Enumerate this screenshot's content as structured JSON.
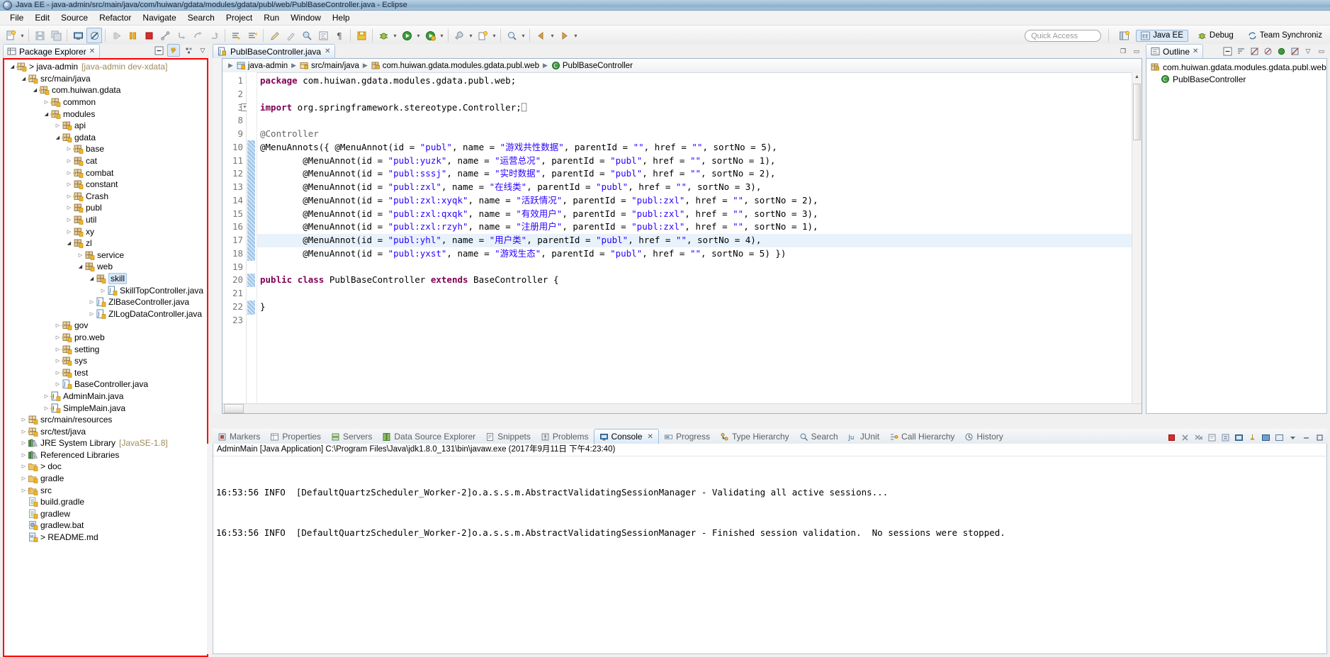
{
  "window": {
    "title": "Java EE - java-admin/src/main/java/com/huiwan/gdata/modules/gdata/publ/web/PublBaseController.java - Eclipse"
  },
  "menubar": {
    "items": [
      "File",
      "Edit",
      "Source",
      "Refactor",
      "Navigate",
      "Search",
      "Project",
      "Run",
      "Window",
      "Help"
    ]
  },
  "toolbar": {
    "quick_access_placeholder": "Quick Access",
    "perspectives": [
      {
        "label": "Java EE",
        "active": true
      },
      {
        "label": "Debug",
        "active": false
      },
      {
        "label": "Team Synchroniz",
        "active": false
      }
    ]
  },
  "package_explorer": {
    "tab_label": "Package Explorer",
    "tools": [
      "collapse-all-icon",
      "link-with-editor-icon",
      "view-menu-icon",
      "minimize-icon",
      "maximize-icon"
    ],
    "tree": [
      {
        "depth": 0,
        "label": "> java-admin",
        "suffix": "[java-admin dev-xdata]",
        "icon": "package-root-warn",
        "state": "open"
      },
      {
        "depth": 1,
        "label": "src/main/java",
        "icon": "source-folder-warn",
        "state": "open"
      },
      {
        "depth": 2,
        "label": "com.huiwan.gdata",
        "icon": "package-warn",
        "state": "open"
      },
      {
        "depth": 3,
        "label": "common",
        "icon": "package-warn",
        "state": "closed"
      },
      {
        "depth": 3,
        "label": "modules",
        "icon": "package-warn",
        "state": "open"
      },
      {
        "depth": 4,
        "label": "api",
        "icon": "package",
        "state": "closed"
      },
      {
        "depth": 4,
        "label": "gdata",
        "icon": "package-warn",
        "state": "open"
      },
      {
        "depth": 5,
        "label": "base",
        "icon": "package-warn",
        "state": "closed"
      },
      {
        "depth": 5,
        "label": "cat",
        "icon": "package",
        "state": "closed"
      },
      {
        "depth": 5,
        "label": "combat",
        "icon": "package-warn",
        "state": "closed"
      },
      {
        "depth": 5,
        "label": "constant",
        "icon": "package",
        "state": "closed"
      },
      {
        "depth": 5,
        "label": "Crash",
        "icon": "package-warn",
        "state": "closed"
      },
      {
        "depth": 5,
        "label": "publ",
        "icon": "package",
        "state": "closed"
      },
      {
        "depth": 5,
        "label": "util",
        "icon": "package",
        "state": "closed"
      },
      {
        "depth": 5,
        "label": "xy",
        "icon": "package",
        "state": "closed"
      },
      {
        "depth": 5,
        "label": "zl",
        "icon": "package",
        "state": "open"
      },
      {
        "depth": 6,
        "label": "service",
        "icon": "package",
        "state": "closed"
      },
      {
        "depth": 6,
        "label": "web",
        "icon": "package",
        "state": "open"
      },
      {
        "depth": 7,
        "label": "skill",
        "icon": "package",
        "state": "open",
        "selected": true
      },
      {
        "depth": 8,
        "label": "SkillTopController.java",
        "icon": "java-file",
        "state": "closed"
      },
      {
        "depth": 7,
        "label": "ZlBaseController.java",
        "icon": "java-file",
        "state": "closed"
      },
      {
        "depth": 7,
        "label": "ZlLogDataController.java",
        "icon": "java-file",
        "state": "closed"
      },
      {
        "depth": 4,
        "label": "gov",
        "icon": "package-warn",
        "state": "closed"
      },
      {
        "depth": 4,
        "label": "pro.web",
        "icon": "package-warn",
        "state": "closed"
      },
      {
        "depth": 4,
        "label": "setting",
        "icon": "package-warn",
        "state": "closed"
      },
      {
        "depth": 4,
        "label": "sys",
        "icon": "package-warn",
        "state": "closed"
      },
      {
        "depth": 4,
        "label": "test",
        "icon": "package-warn",
        "state": "closed"
      },
      {
        "depth": 4,
        "label": "BaseController.java",
        "icon": "java-file",
        "state": "closed"
      },
      {
        "depth": 3,
        "label": "AdminMain.java",
        "icon": "java-file-warn",
        "state": "closed"
      },
      {
        "depth": 3,
        "label": "SimpleMain.java",
        "icon": "java-file-warn",
        "state": "closed"
      },
      {
        "depth": 1,
        "label": "src/main/resources",
        "icon": "source-folder",
        "state": "closed"
      },
      {
        "depth": 1,
        "label": "src/test/java",
        "icon": "source-folder-warn",
        "state": "closed"
      },
      {
        "depth": 1,
        "label": "JRE System Library",
        "suffix": "[JavaSE-1.8]",
        "icon": "library",
        "state": "closed"
      },
      {
        "depth": 1,
        "label": "Referenced Libraries",
        "icon": "library",
        "state": "closed"
      },
      {
        "depth": 1,
        "label": "> doc",
        "icon": "folder",
        "state": "closed"
      },
      {
        "depth": 1,
        "label": "gradle",
        "icon": "folder",
        "state": "closed"
      },
      {
        "depth": 1,
        "label": "src",
        "icon": "folder-warn",
        "state": "closed"
      },
      {
        "depth": 1,
        "label": "build.gradle",
        "icon": "text-file",
        "state": "leaf"
      },
      {
        "depth": 1,
        "label": "gradlew",
        "icon": "text-file",
        "state": "leaf"
      },
      {
        "depth": 1,
        "label": "gradlew.bat",
        "icon": "bat-file",
        "state": "leaf"
      },
      {
        "depth": 1,
        "label": "> README.md",
        "icon": "md-file",
        "state": "leaf"
      }
    ]
  },
  "editor": {
    "tab_label": "PublBaseController.java",
    "breadcrumb": [
      {
        "label": "java-admin",
        "icon": "project-icon"
      },
      {
        "label": "src/main/java",
        "icon": "source-folder-icon"
      },
      {
        "label": "com.huiwan.gdata.modules.gdata.publ.web",
        "icon": "package-icon"
      },
      {
        "label": "PublBaseController",
        "icon": "class-icon"
      }
    ],
    "line_numbers": [
      1,
      2,
      3,
      8,
      9,
      10,
      11,
      12,
      13,
      14,
      15,
      16,
      17,
      18,
      19,
      20,
      21,
      22,
      23
    ],
    "lines": [
      {
        "num": 1,
        "tokens": [
          {
            "t": "package",
            "c": "kw"
          },
          {
            "t": " com.huiwan.gdata.modules.gdata.publ.web;",
            "c": "plain"
          }
        ]
      },
      {
        "num": 2,
        "tokens": []
      },
      {
        "num": 3,
        "fold": true,
        "tokens": [
          {
            "t": "import",
            "c": "kw"
          },
          {
            "t": " org.springframework.stereotype.Controller;",
            "c": "plain"
          },
          {
            "t": "⎕",
            "c": "anno"
          }
        ]
      },
      {
        "num": 8,
        "tokens": []
      },
      {
        "num": 9,
        "tokens": [
          {
            "t": "@Controller",
            "c": "anno"
          }
        ]
      },
      {
        "num": 10,
        "tokens": [
          {
            "t": "@MenuAnnots({ @MenuAnnot(id = ",
            "c": "plain"
          },
          {
            "t": "\"publ\"",
            "c": "str"
          },
          {
            "t": ", name = ",
            "c": "plain"
          },
          {
            "t": "\"游戏共性数据\"",
            "c": "str"
          },
          {
            "t": ", parentId = ",
            "c": "plain"
          },
          {
            "t": "\"\"",
            "c": "str"
          },
          {
            "t": ", href = ",
            "c": "plain"
          },
          {
            "t": "\"\"",
            "c": "str"
          },
          {
            "t": ", sortNo = 5),",
            "c": "plain"
          }
        ]
      },
      {
        "num": 11,
        "tokens": [
          {
            "t": "        @MenuAnnot(id = ",
            "c": "plain"
          },
          {
            "t": "\"publ:yuzk\"",
            "c": "str"
          },
          {
            "t": ", name = ",
            "c": "plain"
          },
          {
            "t": "\"运营总况\"",
            "c": "str"
          },
          {
            "t": ", parentId = ",
            "c": "plain"
          },
          {
            "t": "\"publ\"",
            "c": "str"
          },
          {
            "t": ", href = ",
            "c": "plain"
          },
          {
            "t": "\"\"",
            "c": "str"
          },
          {
            "t": ", sortNo = 1),",
            "c": "plain"
          }
        ]
      },
      {
        "num": 12,
        "tokens": [
          {
            "t": "        @MenuAnnot(id = ",
            "c": "plain"
          },
          {
            "t": "\"publ:sssj\"",
            "c": "str"
          },
          {
            "t": ", name = ",
            "c": "plain"
          },
          {
            "t": "\"实时数据\"",
            "c": "str"
          },
          {
            "t": ", parentId = ",
            "c": "plain"
          },
          {
            "t": "\"publ\"",
            "c": "str"
          },
          {
            "t": ", href = ",
            "c": "plain"
          },
          {
            "t": "\"\"",
            "c": "str"
          },
          {
            "t": ", sortNo = 2),",
            "c": "plain"
          }
        ]
      },
      {
        "num": 13,
        "tokens": [
          {
            "t": "        @MenuAnnot(id = ",
            "c": "plain"
          },
          {
            "t": "\"publ:zxl\"",
            "c": "str"
          },
          {
            "t": ", name = ",
            "c": "plain"
          },
          {
            "t": "\"在线类\"",
            "c": "str"
          },
          {
            "t": ", parentId = ",
            "c": "plain"
          },
          {
            "t": "\"publ\"",
            "c": "str"
          },
          {
            "t": ", href = ",
            "c": "plain"
          },
          {
            "t": "\"\"",
            "c": "str"
          },
          {
            "t": ", sortNo = 3),",
            "c": "plain"
          }
        ]
      },
      {
        "num": 14,
        "tokens": [
          {
            "t": "        @MenuAnnot(id = ",
            "c": "plain"
          },
          {
            "t": "\"publ:zxl:xyqk\"",
            "c": "str"
          },
          {
            "t": ", name = ",
            "c": "plain"
          },
          {
            "t": "\"活跃情况\"",
            "c": "str"
          },
          {
            "t": ", parentId = ",
            "c": "plain"
          },
          {
            "t": "\"publ:zxl\"",
            "c": "str"
          },
          {
            "t": ", href = ",
            "c": "plain"
          },
          {
            "t": "\"\"",
            "c": "str"
          },
          {
            "t": ", sortNo = 2),",
            "c": "plain"
          }
        ]
      },
      {
        "num": 15,
        "tokens": [
          {
            "t": "        @MenuAnnot(id = ",
            "c": "plain"
          },
          {
            "t": "\"publ:zxl:qxqk\"",
            "c": "str"
          },
          {
            "t": ", name = ",
            "c": "plain"
          },
          {
            "t": "\"有效用户\"",
            "c": "str"
          },
          {
            "t": ", parentId = ",
            "c": "plain"
          },
          {
            "t": "\"publ:zxl\"",
            "c": "str"
          },
          {
            "t": ", href = ",
            "c": "plain"
          },
          {
            "t": "\"\"",
            "c": "str"
          },
          {
            "t": ", sortNo = 3),",
            "c": "plain"
          }
        ]
      },
      {
        "num": 16,
        "tokens": [
          {
            "t": "        @MenuAnnot(id = ",
            "c": "plain"
          },
          {
            "t": "\"publ:zxl:rzyh\"",
            "c": "str"
          },
          {
            "t": ", name = ",
            "c": "plain"
          },
          {
            "t": "\"注册用户\"",
            "c": "str"
          },
          {
            "t": ", parentId = ",
            "c": "plain"
          },
          {
            "t": "\"publ:zxl\"",
            "c": "str"
          },
          {
            "t": ", href = ",
            "c": "plain"
          },
          {
            "t": "\"\"",
            "c": "str"
          },
          {
            "t": ", sortNo = 1),",
            "c": "plain"
          }
        ]
      },
      {
        "num": 17,
        "hl": true,
        "tokens": [
          {
            "t": "        @MenuAnnot(id = ",
            "c": "plain"
          },
          {
            "t": "\"publ:yhl\"",
            "c": "str"
          },
          {
            "t": ", name = ",
            "c": "plain"
          },
          {
            "t": "\"用户类\"",
            "c": "str"
          },
          {
            "t": ", parentId = ",
            "c": "plain"
          },
          {
            "t": "\"publ\"",
            "c": "str"
          },
          {
            "t": ", href = ",
            "c": "plain"
          },
          {
            "t": "\"\"",
            "c": "str"
          },
          {
            "t": ", sortNo = 4),",
            "c": "plain"
          }
        ]
      },
      {
        "num": 18,
        "tokens": [
          {
            "t": "        @MenuAnnot(id = ",
            "c": "plain"
          },
          {
            "t": "\"publ:yxst\"",
            "c": "str"
          },
          {
            "t": ", name = ",
            "c": "plain"
          },
          {
            "t": "\"游戏生态\"",
            "c": "str"
          },
          {
            "t": ", parentId = ",
            "c": "plain"
          },
          {
            "t": "\"publ\"",
            "c": "str"
          },
          {
            "t": ", href = ",
            "c": "plain"
          },
          {
            "t": "\"\"",
            "c": "str"
          },
          {
            "t": ", sortNo = 5) })",
            "c": "plain"
          }
        ]
      },
      {
        "num": 19,
        "tokens": []
      },
      {
        "num": 20,
        "tokens": [
          {
            "t": "public",
            "c": "kw"
          },
          {
            "t": " ",
            "c": "plain"
          },
          {
            "t": "class",
            "c": "kw"
          },
          {
            "t": " PublBaseController ",
            "c": "plain"
          },
          {
            "t": "extends",
            "c": "kw"
          },
          {
            "t": " BaseController {",
            "c": "plain"
          }
        ]
      },
      {
        "num": 21,
        "tokens": []
      },
      {
        "num": 22,
        "tokens": [
          {
            "t": "}",
            "c": "plain"
          }
        ]
      },
      {
        "num": 23,
        "tokens": []
      }
    ]
  },
  "outline": {
    "tab_label": "Outline",
    "items": [
      {
        "label": "com.huiwan.gdata.modules.gdata.publ.web",
        "icon": "package-icon",
        "indent": false
      },
      {
        "label": "PublBaseController",
        "icon": "class-icon",
        "indent": true
      }
    ]
  },
  "bottom_panel": {
    "tabs": [
      {
        "label": "Markers",
        "icon": "markers-icon",
        "active": false
      },
      {
        "label": "Properties",
        "icon": "properties-icon",
        "active": false
      },
      {
        "label": "Servers",
        "icon": "servers-icon",
        "active": false
      },
      {
        "label": "Data Source Explorer",
        "icon": "data-source-icon",
        "active": false
      },
      {
        "label": "Snippets",
        "icon": "snippets-icon",
        "active": false
      },
      {
        "label": "Problems",
        "icon": "problems-icon",
        "active": false
      },
      {
        "label": "Console",
        "icon": "console-icon",
        "active": true
      },
      {
        "label": "Progress",
        "icon": "progress-icon",
        "active": false
      },
      {
        "label": "Type Hierarchy",
        "icon": "type-hierarchy-icon",
        "active": false
      },
      {
        "label": "Search",
        "icon": "search-icon",
        "active": false
      },
      {
        "label": "JUnit",
        "icon": "junit-icon",
        "active": false
      },
      {
        "label": "Call Hierarchy",
        "icon": "call-hierarchy-icon",
        "active": false
      },
      {
        "label": "History",
        "icon": "history-icon",
        "active": false
      }
    ],
    "console": {
      "launch_header": "AdminMain [Java Application] C:\\Program Files\\Java\\jdk1.8.0_131\\bin\\javaw.exe (2017年9月11日 下午4:23:40)",
      "output": [
        "16:53:56 INFO  [DefaultQuartzScheduler_Worker-2]o.a.s.s.m.AbstractValidatingSessionManager - Validating all active sessions...",
        "16:53:56 INFO  [DefaultQuartzScheduler_Worker-2]o.a.s.s.m.AbstractValidatingSessionManager - Finished session validation.  No sessions were stopped."
      ]
    }
  },
  "colors": {
    "keyword": "#7f0055",
    "string": "#2a00ff",
    "annotation": "#646464",
    "highlight_row": "#e8f2fb",
    "selection_outline": "#ff0000"
  }
}
